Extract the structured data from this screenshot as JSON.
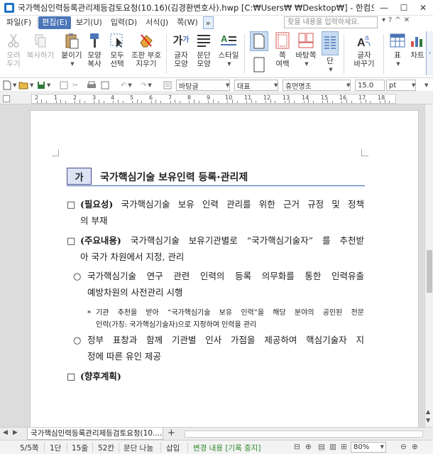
{
  "window": {
    "title": "국가핵심인력등록관리제등검토요청(10.16)(김경환변호사).hwp [C:₩Users₩          ₩Desktop₩] - 한컴오피스 한글",
    "minimize": "—",
    "maximize": "☐",
    "close": "✕"
  },
  "menu": {
    "items": [
      "파일(F)",
      "편집(E)",
      "보기(U)",
      "입력(D)",
      "서식(J)",
      "쪽(W)"
    ],
    "active_index": 1,
    "overflow": "»",
    "search_placeholder": "찾을 내용을 입력하세요.",
    "right_icons": [
      "?",
      "^",
      "✕"
    ]
  },
  "ribbon": {
    "cut": "오려\n두기",
    "copy": "복사하기",
    "paste": "붙이기",
    "format_copy": "모양\n복사",
    "select_all": "모두\n선택",
    "char_remove": "조판 부호\n지우기",
    "char_shape": "글자\n모양",
    "para_shape": "문단\n모양",
    "style": "스타일",
    "page_margin": "쪽\n여백",
    "paper_layout": "바탕쪽",
    "column": "단",
    "text_replace": "글자\n바꾸기",
    "table": "표",
    "chart": "차트"
  },
  "format_bar": {
    "style": "바탕글",
    "lang": "대표",
    "font": "휴먼명조",
    "size": "15.0",
    "unit": "pt"
  },
  "ruler": {
    "labels": [
      "2",
      "1",
      "2",
      "3",
      "4",
      "5",
      "6",
      "7",
      "8",
      "9",
      "10",
      "11",
      "12",
      "13",
      "14",
      "15",
      "16",
      "17",
      "18"
    ]
  },
  "document": {
    "heading_box": "가",
    "heading": "국가핵심기술 보유인력 등록·관리제",
    "p1_mark": "□",
    "p1_lead": "(필요성)",
    "p1_line1_rest": "국가핵심기술 보유 인력 관리를 위한 근거 규정 및 정책",
    "p1_line2": "의 부재",
    "p2_mark": "□",
    "p2_lead": "(주요내용)",
    "p2_line1_rest": "국가핵심기술 보유기관별로 “국가핵심기술자” 를 추천받",
    "p2_line2": "아 국가 차원에서 지정, 관리",
    "b1_mark": "○",
    "b1_line1": "국가핵심기술 연구 관련 인력의 등록 의무화를 통한 인력유출",
    "b1_line2": "예방차원의 사전관리 시행",
    "note_mark": "*",
    "note_line1": "기관 추천을 받아 “국가핵심기술 보유 인력”을 해당 분야의 공인된 전문",
    "note_line2": "인력(가칭: 국가핵심기술자)으로 지정하여 인력을 관리",
    "b2_mark": "○",
    "b2_line1": "정부 표창과 함께 기관별 인사 가점을 제공하여 핵심기술자 지",
    "b2_line2": "정에 따른 유인 제공",
    "p3_mark": "□",
    "p3_lead": "(향후계획)"
  },
  "tabs": {
    "doc_tab": "국가핵심인력등록관리제등검토요청(10....",
    "add": "+"
  },
  "status": {
    "page": "5/5쪽",
    "column": "1단",
    "line": "15줄",
    "col": "52칸",
    "section": "문단 나눔",
    "insert": "삽입",
    "track": "변경 내용 [기록 중지]",
    "zoom": "80%"
  },
  "colors": {
    "accent": "#4a76b8",
    "heading_box_bg": "#dbe3f5",
    "heading_rule": "#3a62b0",
    "track_green": "#2c8a2c"
  }
}
